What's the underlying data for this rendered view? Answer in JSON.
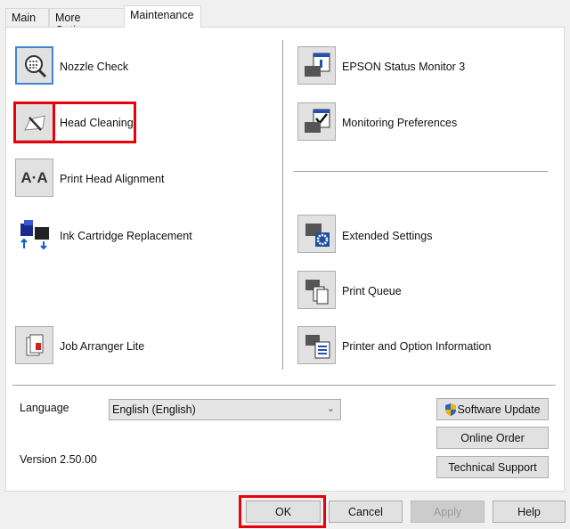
{
  "tabs": [
    {
      "label": "Main"
    },
    {
      "label": "More Options"
    },
    {
      "label": "Maintenance",
      "active": true
    }
  ],
  "left_items": [
    {
      "label": "Nozzle Check",
      "icon": "nozzle-check-icon"
    },
    {
      "label": "Head Cleaning",
      "icon": "head-cleaning-icon"
    },
    {
      "label": "Print Head Alignment",
      "icon": "print-head-alignment-icon",
      "glyph": "A·A"
    },
    {
      "label": "Ink Cartridge Replacement",
      "icon": "ink-cartridge-icon"
    },
    {
      "label": "Job Arranger Lite",
      "icon": "job-arranger-icon"
    }
  ],
  "right_items": [
    {
      "label": "EPSON Status Monitor 3",
      "icon": "status-monitor-icon"
    },
    {
      "label": "Monitoring Preferences",
      "icon": "monitoring-preferences-icon"
    },
    {
      "label": "Extended Settings",
      "icon": "extended-settings-icon"
    },
    {
      "label": "Print Queue",
      "icon": "print-queue-icon"
    },
    {
      "label": "Printer and Option Information",
      "icon": "printer-info-icon"
    }
  ],
  "language": {
    "label": "Language",
    "value": "English (English)"
  },
  "version": "Version 2.50.00",
  "side_buttons": {
    "software_update": "Software Update",
    "online_order": "Online Order",
    "technical_support": "Technical Support"
  },
  "footer": {
    "ok": "OK",
    "cancel": "Cancel",
    "apply": "Apply",
    "help": "Help"
  },
  "colors": {
    "highlight": "#e8000b",
    "selected_border": "#3c87d0"
  }
}
